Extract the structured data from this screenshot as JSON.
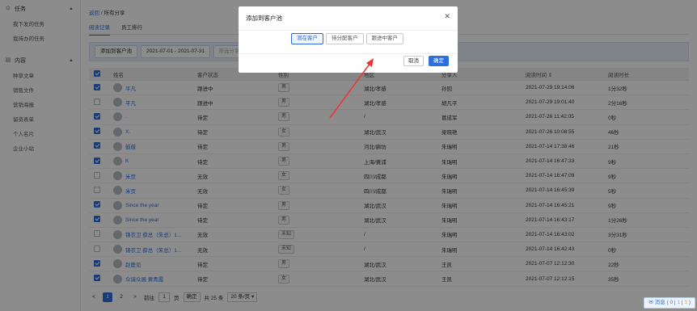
{
  "sidebar": {
    "groups": [
      {
        "label": "任务",
        "items": [
          "我下发的任务",
          "我待办的任务"
        ]
      },
      {
        "label": "内容",
        "items": [
          "种草文章",
          "销售文件",
          "营销海报",
          "留资表单",
          "个人名片",
          "企业小站"
        ]
      }
    ]
  },
  "breadcrumb": {
    "back": "返回",
    "sep": "/",
    "current": "所有分享"
  },
  "tabs": [
    "阅读记录",
    "员工排行"
  ],
  "toolbar": {
    "add_button": "添加到客户池",
    "date_range": "2021-07-01 - 2021-07-31",
    "sharer_placeholder": "筛选分享人"
  },
  "table": {
    "headers": [
      "姓名",
      "客户状态",
      "性别",
      "地区",
      "分享人",
      "阅读时间 ⇕",
      "阅读时长"
    ],
    "rows": [
      {
        "checked": true,
        "name": "平凡",
        "status": "跟进中",
        "gender": "男",
        "region": "湖北/孝感",
        "sharer": "孙回",
        "time": "2021-07-29 19:14:06",
        "duration": "1分32秒"
      },
      {
        "checked": false,
        "name": "平凡",
        "status": "跟进中",
        "gender": "男",
        "region": "湖北/孝感",
        "sharer": "胡凡平",
        "time": "2021-07-29 19:01:40",
        "duration": "2分16秒"
      },
      {
        "checked": true,
        "name": ".",
        "status": "待定",
        "gender": "男",
        "region": "/",
        "sharer": "葛成军",
        "time": "2021-07-26 11:42:05",
        "duration": "0秒"
      },
      {
        "checked": true,
        "name": "X.",
        "status": "待定",
        "gender": "女",
        "region": "湖北/武汉",
        "sharer": "梁晓艳",
        "time": "2021-07-26 10:08:55",
        "duration": "46秒"
      },
      {
        "checked": true,
        "name": "鼓鼓",
        "status": "待定",
        "gender": "男",
        "region": "河北/廊坊",
        "sharer": "朱瑞明",
        "time": "2021-07-14 17:38:46",
        "duration": "21秒"
      },
      {
        "checked": true,
        "name": "K",
        "status": "待定",
        "gender": "男",
        "region": "上海/黄浦",
        "sharer": "朱瑞明",
        "time": "2021-07-14 16:47:33",
        "duration": "9秒"
      },
      {
        "checked": false,
        "name": "米页",
        "status": "无效",
        "gender": "女",
        "region": "四川/成都",
        "sharer": "朱瑞明",
        "time": "2021-07-14 16:47:09",
        "duration": "9秒"
      },
      {
        "checked": false,
        "name": "米页",
        "status": "无效",
        "gender": "女",
        "region": "四川/成都",
        "sharer": "朱瑞明",
        "time": "2021-07-14 16:45:39",
        "duration": "5秒"
      },
      {
        "checked": true,
        "name": "Since the year",
        "status": "待定",
        "gender": "男",
        "region": "湖北/武汉",
        "sharer": "朱瑞明",
        "time": "2021-07-14 16:45:21",
        "duration": "9秒"
      },
      {
        "checked": true,
        "name": "Since the year",
        "status": "待定",
        "gender": "男",
        "region": "湖北/武汉",
        "sharer": "朱瑞明",
        "time": "2021-07-14 16:43:17",
        "duration": "1分26秒"
      },
      {
        "checked": false,
        "name": "锦衣卫 薛总（朱总）1...",
        "status": "无效",
        "gender": "未知",
        "region": "/",
        "sharer": "朱瑞明",
        "time": "2021-07-14 16:43:02",
        "duration": "3分31秒"
      },
      {
        "checked": false,
        "name": "锦衣卫 薛总（朱总）1...",
        "status": "无效",
        "gender": "未知",
        "region": "/",
        "sharer": "朱瑞明",
        "time": "2021-07-14 16:42:43",
        "duration": "0秒"
      },
      {
        "checked": true,
        "name": "赵鹿见",
        "status": "待定",
        "gender": "男",
        "region": "湖北/武汉",
        "sharer": "王凯",
        "time": "2021-07-07 12:12:30",
        "duration": "22秒"
      },
      {
        "checked": true,
        "name": "众诚众展 黄青霞",
        "status": "待定",
        "gender": "女",
        "region": "湖北/武汉",
        "sharer": "王凯",
        "time": "2021-07-07 12:12:15",
        "duration": "35秒"
      }
    ]
  },
  "pager": {
    "prev": "<",
    "pages": [
      "1",
      "2"
    ],
    "next": ">",
    "goto_label": "前往",
    "goto_value": "1",
    "page_suffix": "页",
    "confirm": "确定",
    "total": "共 25 条",
    "size": "20 条/页"
  },
  "messages": {
    "label": "消息",
    "sep1": "(",
    "n1": "0",
    "bar": "|",
    "n2": "1",
    "bar2": "|",
    "n3": "1",
    "sep2": ")"
  },
  "modal": {
    "title": "添加到客户池",
    "options": [
      "潜在客户",
      "待分配客户",
      "跟进中客户"
    ],
    "selected_index": 0,
    "cancel": "取消",
    "ok": "确定"
  },
  "colors": {
    "accent": "#2f6fdc",
    "arrow": "#e53935"
  }
}
